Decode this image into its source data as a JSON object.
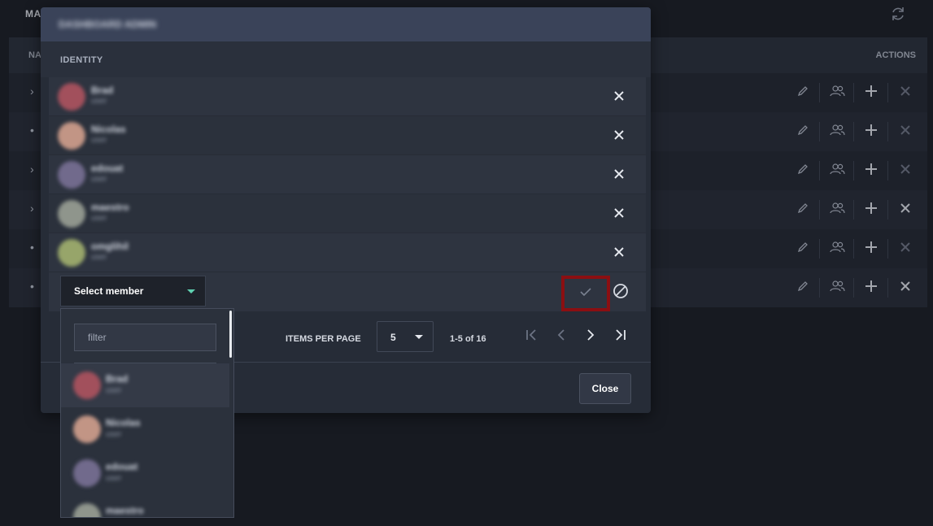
{
  "background": {
    "page_title": "MA",
    "table": {
      "col_name": "NA",
      "col_actions": "ACTIONS",
      "rows": [
        {
          "expander": "›"
        },
        {
          "expander": "•"
        },
        {
          "expander": "›"
        },
        {
          "expander": "›"
        },
        {
          "expander": "•"
        },
        {
          "expander": "•"
        }
      ]
    }
  },
  "modal": {
    "title": "DASHBOARD ADMIN",
    "column_identity": "IDENTITY",
    "members": [
      {
        "name": "Brad",
        "role": "user",
        "avatar_color": "#a2505c"
      },
      {
        "name": "Nicolas",
        "role": "user",
        "avatar_color": "#c29585"
      },
      {
        "name": "edouat",
        "role": "user",
        "avatar_color": "#716a8c"
      },
      {
        "name": "maestro",
        "role": "user",
        "avatar_color": "#8f958c"
      },
      {
        "name": "omglihil",
        "role": "user",
        "avatar_color": "#97a56a"
      }
    ],
    "add_member": {
      "select_label": "Select member"
    },
    "pagination": {
      "items_per_page_label": "ITEMS PER PAGE",
      "items_per_page_value": "5",
      "range_text": "1-5 of 16"
    },
    "close_label": "Close"
  },
  "dropdown": {
    "filter_placeholder": "filter",
    "options": [
      {
        "name": "Brad",
        "role": "user",
        "avatar_color": "#a2505c"
      },
      {
        "name": "Nicolas",
        "role": "user",
        "avatar_color": "#c29585"
      },
      {
        "name": "edouat",
        "role": "user",
        "avatar_color": "#716a8c"
      },
      {
        "name": "maestro",
        "role": "user",
        "avatar_color": "#8f958c"
      }
    ]
  },
  "colors": {
    "accent_caret": "#5fd0b0",
    "highlight_box": "#8b0f12",
    "modal_header": "#3a4359"
  },
  "icons": {
    "remove": "close-icon",
    "confirm": "check-icon",
    "cancel": "cancel-icon",
    "refresh": "refresh-icon",
    "edit": "pencil-icon",
    "members": "users-icon",
    "add": "plus-icon",
    "delete": "close-icon"
  }
}
